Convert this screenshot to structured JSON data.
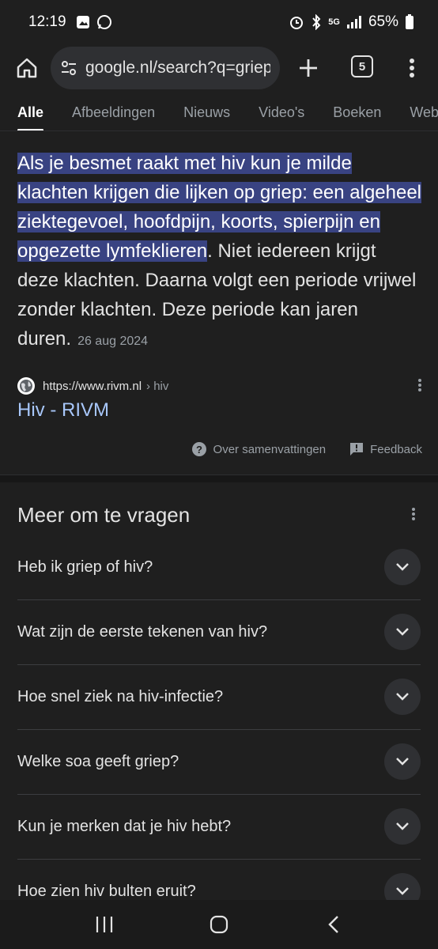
{
  "status_bar": {
    "time": "12:19",
    "battery": "65%",
    "network": "5G"
  },
  "browser": {
    "url": "google.nl/search?q=griep",
    "tab_count": "5"
  },
  "search_tabs": [
    "Alle",
    "Afbeeldingen",
    "Nieuws",
    "Video's",
    "Boeken",
    "Web"
  ],
  "snippet": {
    "highlighted": "Als je besmet raakt met hiv kun je milde klachten krijgen die lijken op griep: een algeheel ziektegevoel, hoofdpijn, koorts, spierpijn en opgezette lymfeklieren",
    "rest": ". Niet iedereen krijgt deze klachten. Daarna volgt een periode vrijwel zonder klachten. Deze periode kan jaren duren.",
    "date": "26 aug 2024"
  },
  "source": {
    "url": "https://www.rivm.nl",
    "path": "› hiv",
    "title": "Hiv - RIVM"
  },
  "footer": {
    "about": "Over samenvattingen",
    "feedback": "Feedback"
  },
  "paa": {
    "title": "Meer om te vragen",
    "questions": [
      "Heb ik griep of hiv?",
      "Wat zijn de eerste tekenen van hiv?",
      "Hoe snel ziek na hiv-infectie?",
      "Welke soa geeft griep?",
      "Kun je merken dat je hiv hebt?",
      "Hoe zien hiv bulten eruit?"
    ]
  },
  "colors": {
    "background": "#1f1f1f",
    "highlight": "#394382",
    "link": "#a8c7fa"
  }
}
